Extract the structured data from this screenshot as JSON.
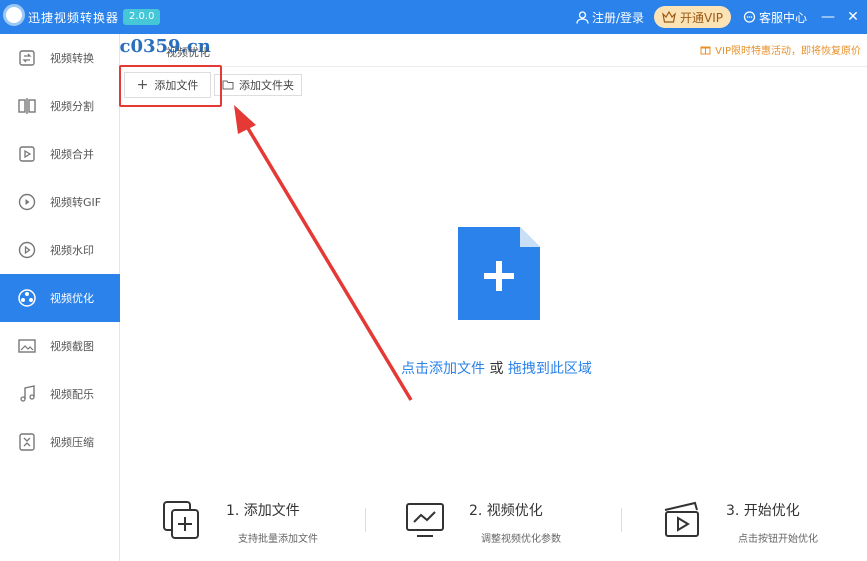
{
  "titlebar": {
    "app_title": "迅捷视频转换器",
    "version_badge": "2.0.0",
    "login": "注册/登录",
    "vip_button": "开通VIP",
    "support": "客服中心",
    "minimize": "—",
    "close": "✕"
  },
  "watermark": "www.pc0359.cn",
  "header": {
    "page_title": "视频优化",
    "promo": "VIP限时特惠活动，即将恢复原价"
  },
  "sidebar": {
    "items": [
      {
        "label": "视频转换",
        "icon": "convert-icon"
      },
      {
        "label": "视频分割",
        "icon": "split-icon"
      },
      {
        "label": "视频合并",
        "icon": "merge-icon"
      },
      {
        "label": "视频转GIF",
        "icon": "gif-icon"
      },
      {
        "label": "视频水印",
        "icon": "watermark-icon"
      },
      {
        "label": "视频优化",
        "icon": "optimize-icon",
        "active": true
      },
      {
        "label": "视频截图",
        "icon": "screenshot-icon"
      },
      {
        "label": "视频配乐",
        "icon": "music-icon"
      },
      {
        "label": "视频压缩",
        "icon": "compress-icon"
      }
    ]
  },
  "toolbar": {
    "add_file": "添加文件",
    "add_folder": "添加文件夹"
  },
  "dropzone": {
    "link1": "点击添加文件",
    "or": " 或 ",
    "link2": "拖拽到此区域"
  },
  "steps": [
    {
      "title": "1. 添加文件",
      "desc": "支持批量添加文件"
    },
    {
      "title": "2. 视频优化",
      "desc": "调整视频优化参数"
    },
    {
      "title": "3. 开始优化",
      "desc": "点击按钮开始优化"
    }
  ],
  "colors": {
    "primary": "#2b82ea",
    "highlight": "#e53935",
    "vip_bg": "#fbe3b5",
    "promo": "#e8912b"
  }
}
